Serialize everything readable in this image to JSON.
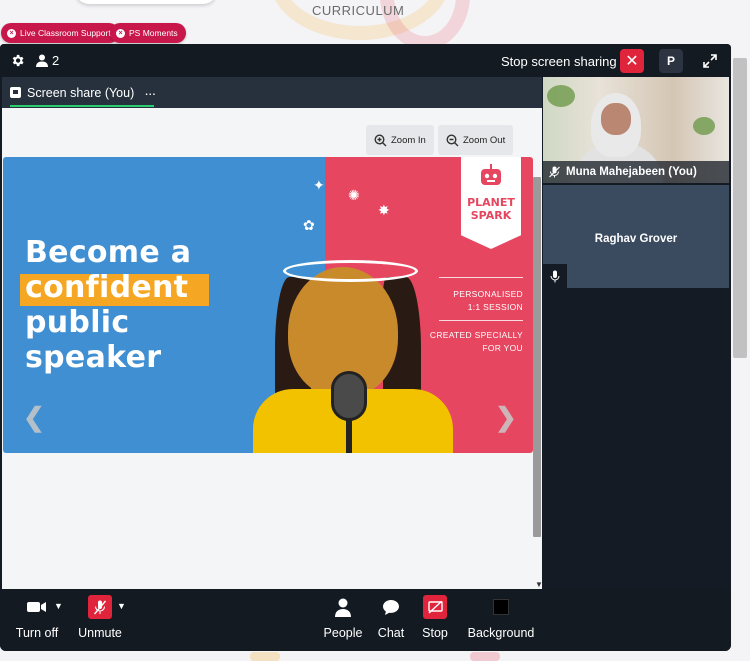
{
  "page": {
    "header_text": "CURRICULUM",
    "tags": [
      {
        "label": "Live Classroom Support"
      },
      {
        "label": "PS Moments"
      }
    ]
  },
  "topbar": {
    "participant_count": "2",
    "stop_sharing_label": "Stop screen sharing",
    "avatar_initial": "P"
  },
  "share": {
    "tab_label": "Screen share (You)",
    "more_label": "···",
    "zoom_in_label": "Zoom In",
    "zoom_out_label": "Zoom Out"
  },
  "slide": {
    "line1": "Become a",
    "line2": "confident",
    "line3": "public",
    "line4": "speaker",
    "logo_line1": "PLANET",
    "logo_line2": "SPARK",
    "side_text1_a": "PERSONALISED",
    "side_text1_b": "1:1 SESSION",
    "side_text2_a": "CREATED SPECIALLY",
    "side_text2_b": "FOR YOU",
    "prev_glyph": "❮",
    "next_glyph": "❯"
  },
  "participants": [
    {
      "name": "Muna Mahejabeen (You)",
      "muted": true
    },
    {
      "name": "Raghav Grover",
      "muted": false
    }
  ],
  "controls": {
    "camera": "Turn off",
    "mic": "Unmute",
    "people": "People",
    "chat": "Chat",
    "stop": "Stop",
    "background": "Background"
  },
  "colors": {
    "accent_red": "#e0243c",
    "tag_pink": "#c8174b",
    "tab_underline": "#2ecc71",
    "slide_blue": "#3f8fd2",
    "slide_pink": "#e6465f",
    "highlight_orange": "#f5a623"
  },
  "icons": [
    "gear-icon",
    "person-icon",
    "close-icon",
    "fullscreen-icon",
    "screen-icon",
    "zoom-in-icon",
    "zoom-out-icon",
    "mic-muted-icon",
    "mic-icon",
    "camera-icon",
    "chevron-down-icon",
    "people-icon",
    "chat-icon",
    "stop-share-icon",
    "background-icon"
  ]
}
